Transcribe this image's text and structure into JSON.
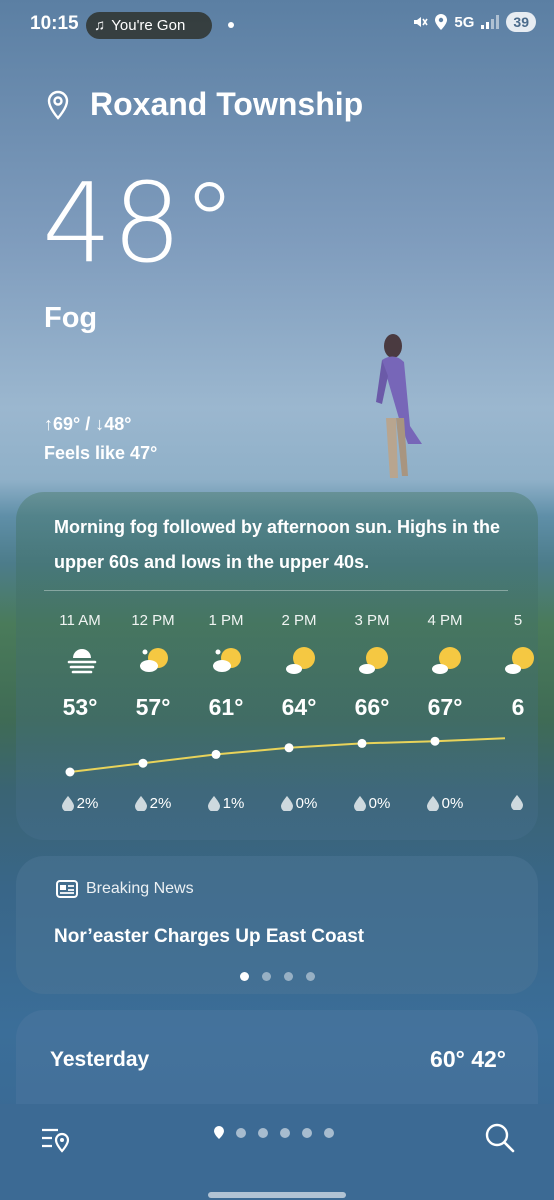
{
  "status_bar": {
    "time": "10:15",
    "media_text": "You're Gon",
    "network": "5G",
    "battery": "39"
  },
  "location": {
    "name": "Roxand Township"
  },
  "current": {
    "temperature": "48°",
    "condition": "Fog",
    "high_low": "↑69° / ↓48°",
    "feels_like": "Feels like 47°"
  },
  "forecast": {
    "summary": "Morning fog followed by afternoon sun. Highs in the upper 60s and lows in the upper 40s.",
    "hours": [
      {
        "time": "11 AM",
        "temp": "53°",
        "temp_value": 53,
        "precip": "2%",
        "icon": "fog-icon"
      },
      {
        "time": "12 PM",
        "temp": "57°",
        "temp_value": 57,
        "precip": "2%",
        "icon": "partly-sunny-icon"
      },
      {
        "time": "1 PM",
        "temp": "61°",
        "temp_value": 61,
        "precip": "1%",
        "icon": "partly-sunny-icon"
      },
      {
        "time": "2 PM",
        "temp": "64°",
        "temp_value": 64,
        "precip": "0%",
        "icon": "mostly-sunny-icon"
      },
      {
        "time": "3 PM",
        "temp": "66°",
        "temp_value": 66,
        "precip": "0%",
        "icon": "mostly-sunny-icon"
      },
      {
        "time": "4 PM",
        "temp": "67°",
        "temp_value": 67,
        "precip": "0%",
        "icon": "mostly-sunny-icon"
      },
      {
        "time": "5",
        "temp": "6",
        "precip": "",
        "icon": "mostly-sunny-icon"
      }
    ]
  },
  "news": {
    "header": "Breaking News",
    "title": "Nor’easter Charges Up East Coast",
    "page_count": 4,
    "active_page": 0
  },
  "yesterday": {
    "label": "Yesterday",
    "temps": "60° 42°"
  },
  "nav": {
    "page_count": 6,
    "active_page": 0
  },
  "colors": {
    "sun": "#f5c842",
    "curve": "#e8d35a",
    "bottom_bar": "#3c6a94"
  }
}
